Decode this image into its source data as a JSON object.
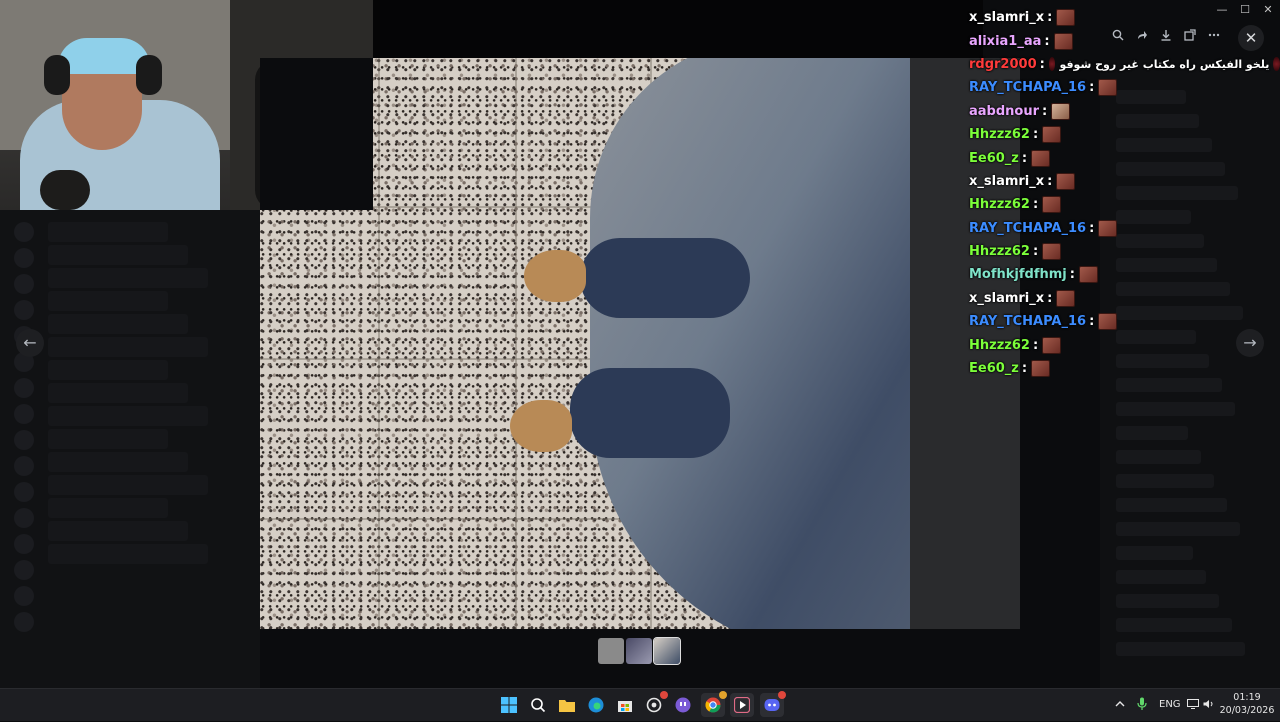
{
  "window": {
    "controls": [
      "—",
      "☐",
      "✕"
    ]
  },
  "toolbar": {
    "icons": [
      "zoom-icon",
      "forward-icon",
      "download-icon",
      "open-external-icon",
      "more-icon"
    ],
    "close": "✕"
  },
  "chat": [
    {
      "user": "x_slamri_x",
      "color": "#ffffff",
      "emote": "emote"
    },
    {
      "user": "alixia1_aa",
      "color": "#e9a6ff",
      "emote": "emote"
    },
    {
      "user": "rdgr2000",
      "color": "#ff3b3b",
      "emote": "dark",
      "message": "يلخو الفيكس راه مكتاب غير روح شوفو"
    },
    {
      "user": "RAY_TCHAPA_16",
      "color": "#3c8cff",
      "emote": "emote"
    },
    {
      "user": "aabdnour",
      "color": "#e9a6ff",
      "emote": "pale"
    },
    {
      "user": "Hhzzz62",
      "color": "#7cff3a",
      "emote": "emote"
    },
    {
      "user": "Ee60_z",
      "color": "#7cff3a",
      "emote": "emote"
    },
    {
      "user": "x_slamri_x",
      "color": "#ffffff",
      "emote": "emote"
    },
    {
      "user": "Hhzzz62",
      "color": "#7cff3a",
      "emote": "emote"
    },
    {
      "user": "RAY_TCHAPA_16",
      "color": "#3c8cff",
      "emote": "emote"
    },
    {
      "user": "Hhzzz62",
      "color": "#7cff3a",
      "emote": "emote"
    },
    {
      "user": "Mofhkjfdfhmj",
      "color": "#7fe3c9",
      "emote": "emote"
    },
    {
      "user": "x_slamri_x",
      "color": "#ffffff",
      "emote": "emote"
    },
    {
      "user": "RAY_TCHAPA_16",
      "color": "#3c8cff",
      "emote": "emote"
    },
    {
      "user": "Hhzzz62",
      "color": "#7cff3a",
      "emote": "emote"
    },
    {
      "user": "Ee60_z",
      "color": "#7cff3a",
      "emote": "emote"
    }
  ],
  "viewer": {
    "prev": "←",
    "next": "→"
  },
  "taskbar": {
    "tray_lang": "ENG",
    "time": "01:19",
    "date": "20/03/2026"
  }
}
